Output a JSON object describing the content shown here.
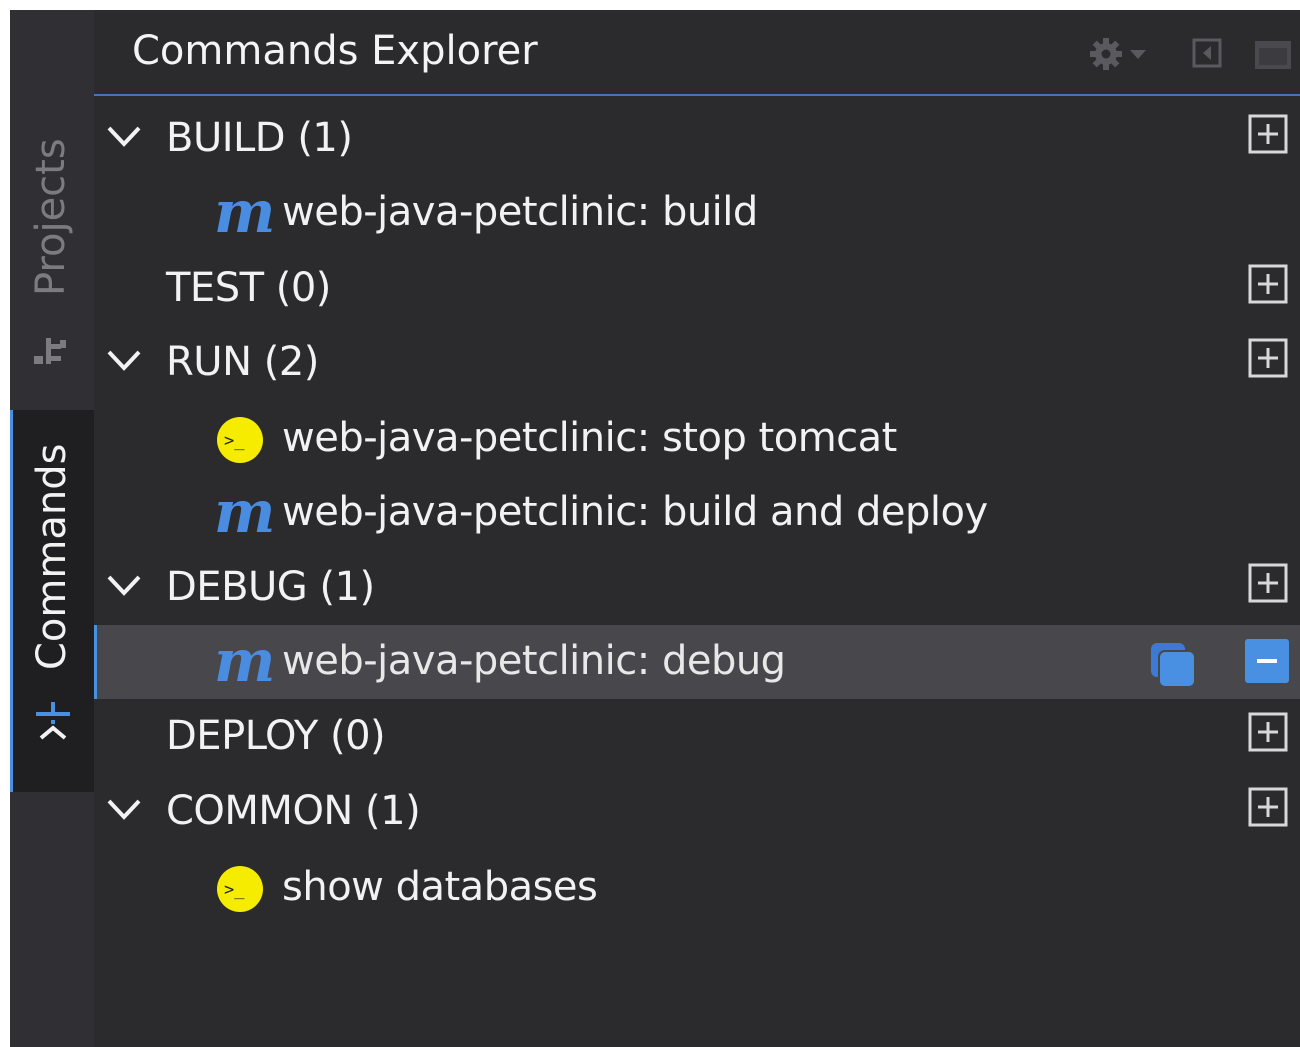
{
  "panel": {
    "title": "Commands Explorer"
  },
  "side_tabs": [
    {
      "label": "Projects",
      "icon": "project-tree-icon",
      "active": false
    },
    {
      "label": "Commands",
      "icon": "commands-icon",
      "active": true
    }
  ],
  "toolbar": {
    "icons": [
      "gear-icon",
      "chevron-down-icon",
      "collapse-panel-icon",
      "maximize-icon"
    ]
  },
  "tree": {
    "groups": [
      {
        "label": "BUILD (1)",
        "expanded": true
      },
      {
        "label": "TEST (0)",
        "expanded": false
      },
      {
        "label": "RUN (2)",
        "expanded": true
      },
      {
        "label": "DEBUG (1)",
        "expanded": true
      },
      {
        "label": "DEPLOY (0)",
        "expanded": false
      },
      {
        "label": "COMMON (1)",
        "expanded": true
      }
    ],
    "commands": [
      {
        "label": "web-java-petclinic: build",
        "type": "maven",
        "icon_text": "m"
      },
      {
        "label": "web-java-petclinic: stop tomcat",
        "type": "shell",
        "icon_text": ">_"
      },
      {
        "label": "web-java-petclinic: build and deploy",
        "type": "maven",
        "icon_text": "m"
      },
      {
        "label": "web-java-petclinic: debug",
        "type": "maven",
        "icon_text": "m",
        "selected": true
      },
      {
        "label": "show databases",
        "type": "shell",
        "icon_text": ">_"
      }
    ]
  },
  "colors": {
    "background": "#2b2b2e",
    "accent": "#4a90e2",
    "maven_icon": "#4a8de0",
    "shell_icon": "#f5ec00",
    "selection": "#47474c"
  }
}
